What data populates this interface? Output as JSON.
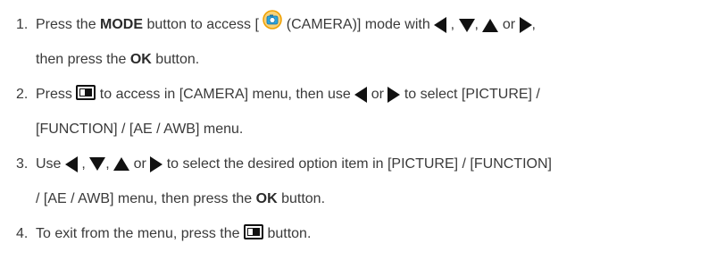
{
  "steps": [
    {
      "number": "1.",
      "line1": {
        "t1": "Press the ",
        "bold1": "MODE",
        "t2": " button to access [",
        "t3": " (CAMERA)] mode with ",
        "sep1": " , ",
        "sep2": ", ",
        "sep3": " or ",
        "sep4": ","
      },
      "line2": {
        "t1": "then press the ",
        "bold1": "OK",
        "t2": " button."
      }
    },
    {
      "number": "2.",
      "line1": {
        "t1": "Press ",
        "t2": " to access in [CAMERA] menu, then use ",
        "sep1": " or ",
        "t3": " to select [PICTURE] /"
      },
      "line2": {
        "t1": "[FUNCTION] / [AE / AWB] menu."
      }
    },
    {
      "number": "3.",
      "line1": {
        "t1": "Use ",
        "sep1": " , ",
        "sep2": ", ",
        "sep3": " or ",
        "t2": " to select the desired option item in [PICTURE] / [FUNCTION]"
      },
      "line2": {
        "t1": "/ [AE / AWB] menu, then press the ",
        "bold1": "OK",
        "t2": " button."
      }
    },
    {
      "number": "4.",
      "line1": {
        "t1": "To exit from the menu, press the ",
        "t2": " button."
      }
    }
  ],
  "icons": {
    "left": "left-arrow-icon",
    "down": "down-arrow-icon",
    "up": "up-arrow-icon",
    "right": "right-arrow-icon",
    "menu": "menu-button-icon",
    "camera": "camera-mode-icon"
  },
  "colors": {
    "text": "#3a3a3a",
    "icon": "#111111",
    "camera_icon_ring": "#f0a000",
    "camera_icon_fill": "#2aa7e0"
  }
}
